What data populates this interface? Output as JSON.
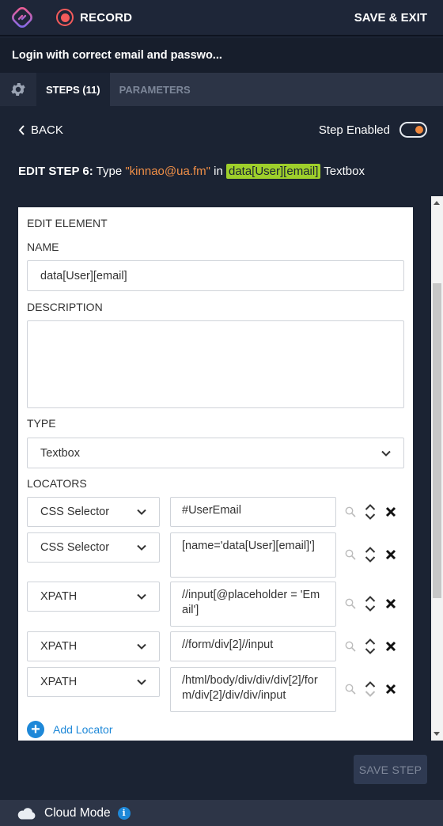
{
  "app": {
    "record_label": "RECORD",
    "save_exit_label": "SAVE & EXIT"
  },
  "test": {
    "title": "Login with correct email and passwo..."
  },
  "tabs": {
    "steps": "STEPS (11)",
    "parameters": "PARAMETERS"
  },
  "nav": {
    "back_label": "BACK",
    "step_enabled_label": "Step Enabled",
    "step_enabled": true
  },
  "edit_step": {
    "prefix": "EDIT STEP 6:",
    "action": "Type",
    "value": "\"kinnao@ua.fm\"",
    "in_text": "in",
    "element": "data[User][email]",
    "element_type": "Textbox"
  },
  "edit_element": {
    "section_title": "EDIT ELEMENT",
    "name_label": "NAME",
    "name_value": "data[User][email]",
    "description_label": "DESCRIPTION",
    "description_value": "",
    "type_label": "TYPE",
    "type_value": "Textbox",
    "locators_label": "LOCATORS",
    "locators": [
      {
        "type": "CSS Selector",
        "value": "#UserEmail"
      },
      {
        "type": "CSS Selector",
        "value": "[name='data[User][email]']"
      },
      {
        "type": "XPATH",
        "value": "//input[@placeholder = 'Email']"
      },
      {
        "type": "XPATH",
        "value": "//form/div[2]//input"
      },
      {
        "type": "XPATH",
        "value": "/html/body/div/div/div[2]/form/div[2]/div/div/input"
      }
    ],
    "add_locator_label": "Add Locator"
  },
  "actions": {
    "save_step_label": "SAVE STEP"
  },
  "footer": {
    "mode_label": "Cloud Mode"
  },
  "colors": {
    "background": "#1b2333",
    "accent_orange": "#f08f47",
    "element_highlight": "#9ecf2b",
    "record_red": "#f45b5b",
    "link_blue": "#1e88d8"
  },
  "icons": [
    "app-logo-icon",
    "record-icon",
    "gear-icon",
    "chevron-left-icon",
    "chevron-down-icon",
    "search-icon",
    "reorder-icon",
    "delete-icon",
    "plus-icon",
    "cloud-icon",
    "info-icon"
  ]
}
